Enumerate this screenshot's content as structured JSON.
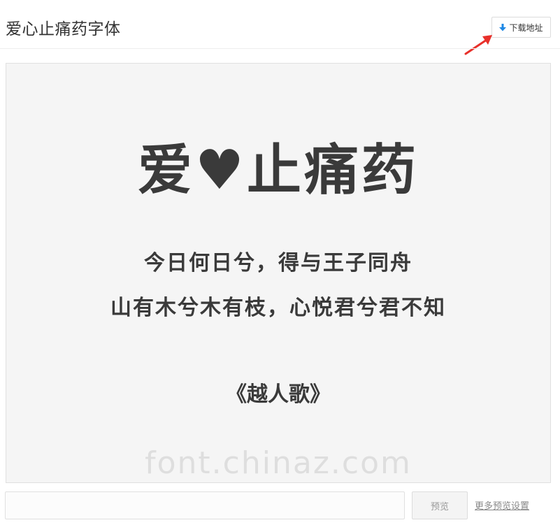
{
  "header": {
    "title": "爱心止痛药字体",
    "download_label": "下载地址"
  },
  "preview": {
    "title_part1": "爱",
    "title_heart": "♥",
    "title_part2": "止痛药",
    "line1": "今日何日兮，得与王子同舟",
    "line2": "山有木兮木有枝，心悦君兮君不知",
    "source": "《越人歌》",
    "watermark": "font.chinaz.com"
  },
  "controls": {
    "input_placeholder": "",
    "preview_button": "预览",
    "more_settings": "更多预览设置"
  },
  "colors": {
    "accent_arrow": "#e8302a",
    "download_icon": "#1e88e5"
  }
}
